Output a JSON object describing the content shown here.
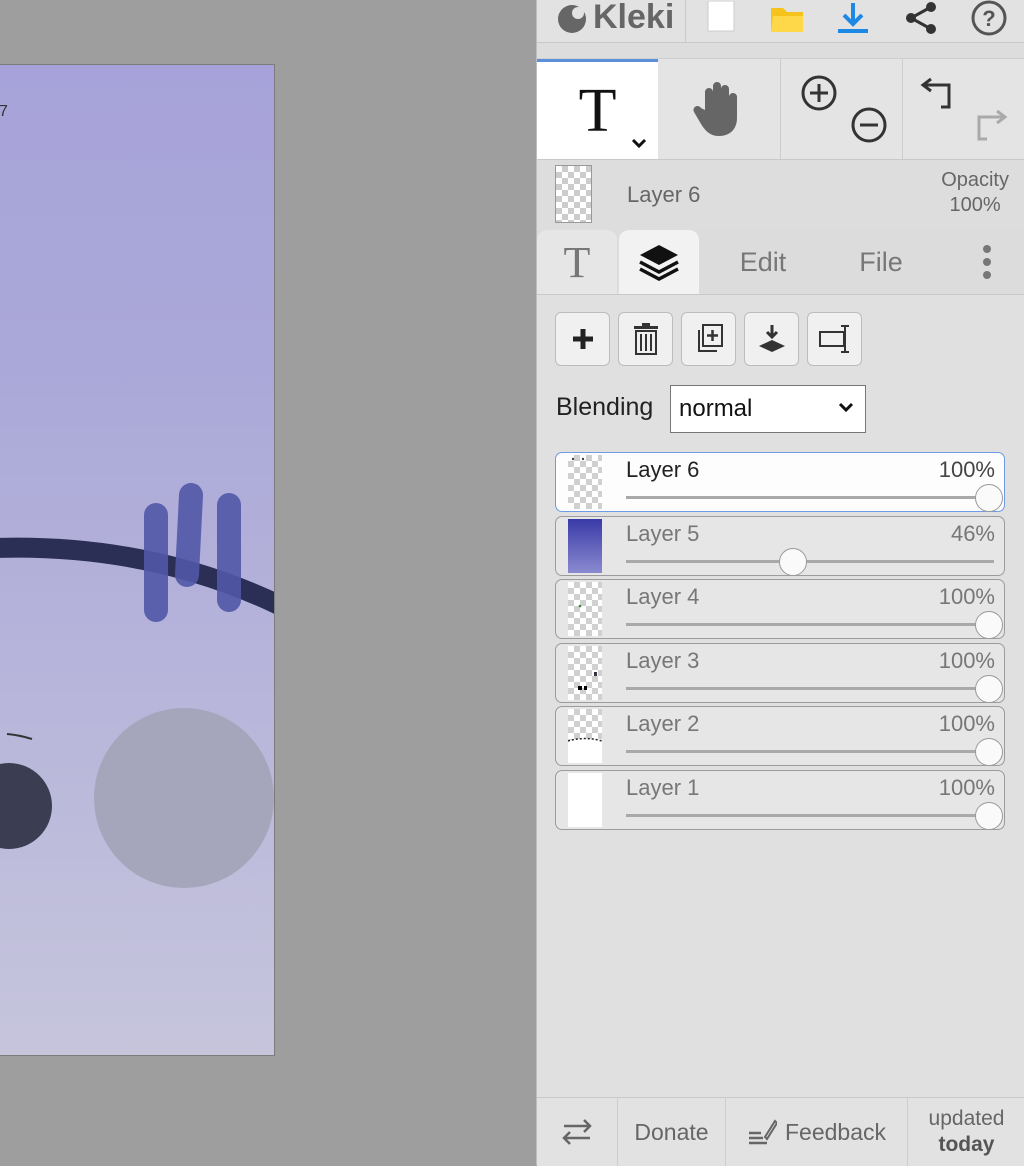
{
  "app": {
    "name": "Kleki"
  },
  "canvas": {
    "corner_text": "7",
    "colors": {
      "background_top": "#a7a3da",
      "background_bottom": "#c6c5dc",
      "arc": "#2b2f55",
      "strokes": "#5158a8",
      "dark_circle": "#3b3d52",
      "light_circle": "#a5a6bb"
    }
  },
  "topbar": {
    "icons": [
      "kleki-logo-icon",
      "new-file-icon",
      "open-folder-icon",
      "download-icon",
      "share-icon",
      "help-icon"
    ]
  },
  "tools": {
    "active": "text",
    "items": [
      "text-tool-icon",
      "hand-tool-icon",
      "zoom-in-icon",
      "zoom-out-icon",
      "undo-icon",
      "redo-icon"
    ]
  },
  "current_layer": {
    "name": "Layer 6",
    "opacity_label": "Opacity",
    "opacity_value": "100%"
  },
  "tabs": [
    {
      "id": "text",
      "label": "T"
    },
    {
      "id": "layers",
      "label": ""
    },
    {
      "id": "edit",
      "label": "Edit"
    },
    {
      "id": "file",
      "label": "File"
    }
  ],
  "layer_buttons": [
    "add-layer-button",
    "delete-layer-button",
    "duplicate-layer-button",
    "merge-down-button",
    "rename-layer-button"
  ],
  "blending": {
    "label": "Blending",
    "value": "normal"
  },
  "layers": [
    {
      "name": "Layer 6",
      "pct": "100%",
      "opacity": 1.0,
      "active": true
    },
    {
      "name": "Layer 5",
      "pct": "46%",
      "opacity": 0.46,
      "active": false
    },
    {
      "name": "Layer 4",
      "pct": "100%",
      "opacity": 1.0,
      "active": false
    },
    {
      "name": "Layer 3",
      "pct": "100%",
      "opacity": 1.0,
      "active": false
    },
    {
      "name": "Layer 2",
      "pct": "100%",
      "opacity": 1.0,
      "active": false
    },
    {
      "name": "Layer 1",
      "pct": "100%",
      "opacity": 1.0,
      "active": false
    }
  ],
  "footer": {
    "donate": "Donate",
    "feedback": "Feedback",
    "updated_line1": "updated",
    "updated_line2": "today"
  },
  "colors": {
    "accent": "#5b8fdc",
    "panel": "#dddddd",
    "workspace": "#9e9e9e"
  }
}
